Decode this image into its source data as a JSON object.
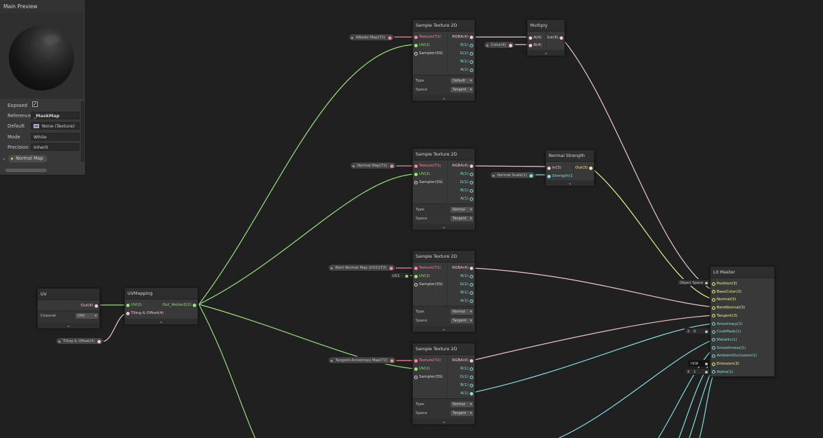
{
  "main_preview": {
    "title": "Main Preview",
    "properties": {
      "exposed_label": "Exposed",
      "exposed_checked": true,
      "reference_label": "Reference",
      "reference_value": "_MaskMap",
      "default_label": "Default",
      "default_value": "None (Texture)",
      "mode_label": "Mode",
      "mode_value": "White",
      "precision_label": "Precision",
      "precision_value": "Inherit",
      "keyword": "Normal Map"
    }
  },
  "port_colors": {
    "texture": "#f28a9e",
    "vector2": "#9be380",
    "sampler": "#dcdcdc",
    "vector4": "#f3c6d6",
    "vector3": "#f4f28c",
    "vector1": "#86dde3"
  },
  "nodes": {
    "uv": {
      "title": "UV",
      "out": "Out(4)",
      "channel_label": "Channel",
      "channel_value": "UV0"
    },
    "uvmapping": {
      "title": "UVMapping",
      "in_uv": "UV(2)",
      "in_tiling": "Tiling & Offset(4)",
      "out": "Out_Vector2(2)"
    },
    "st1": {
      "title": "Sample Texture 2D",
      "type": "Default",
      "space": "Tangent"
    },
    "st2": {
      "title": "Sample Texture 2D",
      "type": "Normal",
      "space": "Tangent"
    },
    "st3": {
      "title": "Sample Texture 2D",
      "type": "Normal",
      "space": "Tangent"
    },
    "st4": {
      "title": "Sample Texture 2D",
      "type": "Normal",
      "space": "Tangent"
    },
    "sample_ports": {
      "texture": "Texture(T2)",
      "uv": "UV(2)",
      "sampler": "Sampler(SS)",
      "rgba": "RGBA(4)",
      "r": "R(1)",
      "g": "G(1)",
      "b": "B(1)",
      "a": "A(1)",
      "type_label": "Type",
      "space_label": "Space"
    },
    "multiply": {
      "title": "Multiply",
      "in_a": "A(4)",
      "in_b": "B(4)",
      "out": "Out(4)"
    },
    "normal_strength": {
      "title": "Normal Strength",
      "in_in": "In(3)",
      "in_strength": "Strength(1)",
      "out": "Out(3)"
    },
    "lit_master": {
      "title": "Lit Master",
      "inputs": [
        "Position(3)",
        "BaseColor(3)",
        "Normal(3)",
        "BentNormal(3)",
        "Tangent(3)",
        "Anisotropy(1)",
        "CoatMask(1)",
        "Metallic(1)",
        "Smoothness(1)",
        "AmbientOcclusion(1)",
        "Emission(3)",
        "Alpha(1)"
      ]
    }
  },
  "properties_on_graph": {
    "albedo_map": "Albedo Map(T2)",
    "color": "Color(4)",
    "normal_map": "Normal Map(T2)",
    "normal_scale": "Normal Scale(1)",
    "bent_normal_map": "Bent Normal Map (UV2)(T2)",
    "uv2": "UV2",
    "tangent_anisotropy_map": "Tangent-Anisotropy Map(T2)",
    "tiling_offset": "Tiling & Offset(4)"
  },
  "inline_inputs": {
    "object_space": "Object Space",
    "coatmask_x": "X",
    "coatmask_val": "0",
    "hdr": "HDR",
    "alpha_x": "X",
    "alpha_val": "1"
  }
}
